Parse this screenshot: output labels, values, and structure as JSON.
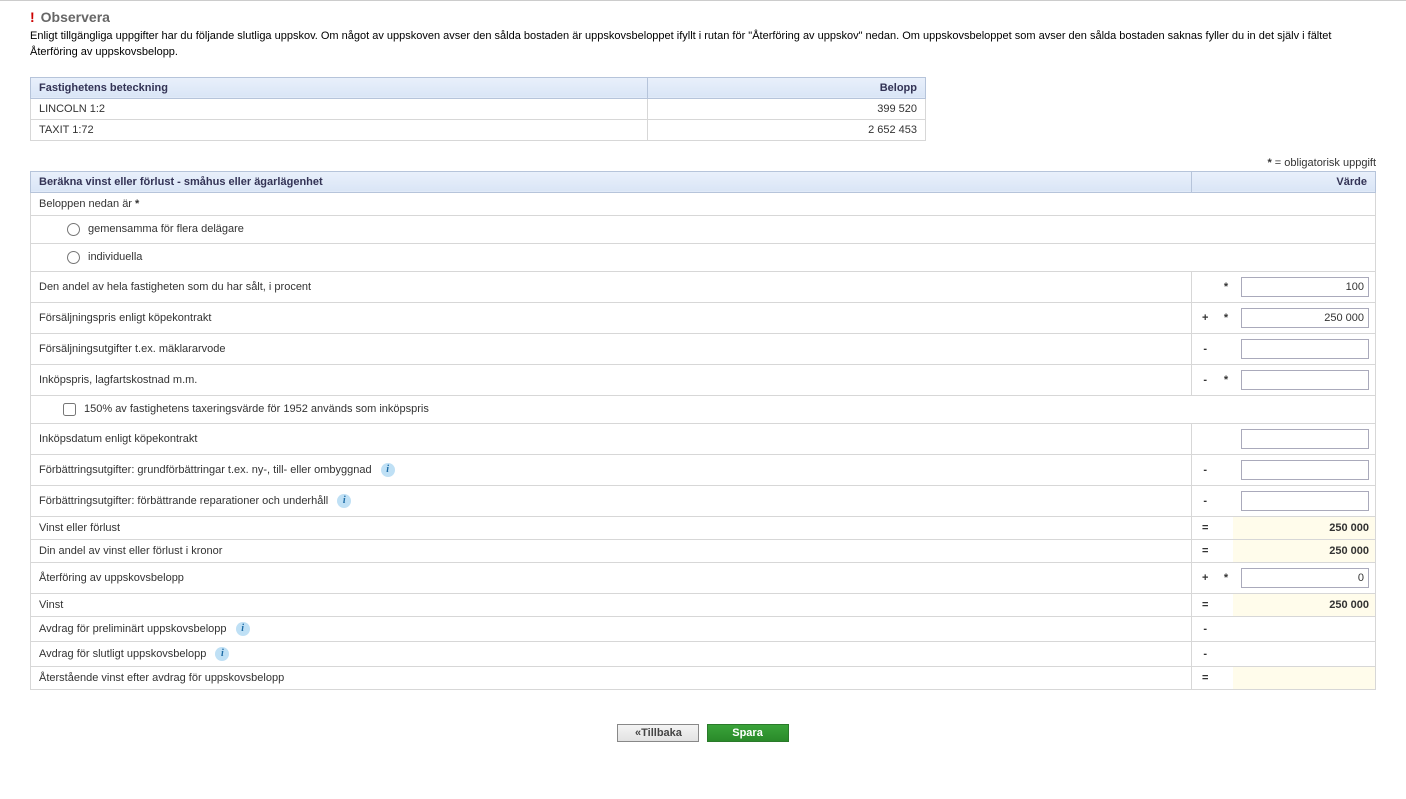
{
  "notice": {
    "title": "Observera",
    "body": "Enligt tillgängliga uppgifter har du följande slutliga uppskov. Om något av uppskoven avser den sålda bostaden är uppskovsbeloppet ifyllt i rutan för \"Återföring av uppskov\" nedan. Om uppskovsbeloppet som avser den sålda bostaden saknas fyller du in det själv i fältet Återföring av uppskovsbelopp."
  },
  "data_table": {
    "headers": {
      "designation": "Fastighetens beteckning",
      "amount": "Belopp"
    },
    "rows": [
      {
        "designation": "LINCOLN 1:2",
        "amount": "399 520"
      },
      {
        "designation": "TAXIT 1:72",
        "amount": "2 652 453"
      }
    ]
  },
  "mandatory_note": {
    "ast": "*",
    "text": "= obligatorisk uppgift"
  },
  "form": {
    "header_left": "Beräkna vinst eller förlust - småhus eller ägarlägenhet",
    "header_right": "Värde",
    "group_label": "Beloppen nedan är",
    "radio_shared": "gemensamma för flera delägare",
    "radio_individual": "individuella",
    "rows": {
      "share": {
        "label": "Den andel av hela fastigheten som du har sålt, i procent",
        "op": "",
        "ast": "*",
        "value": "100"
      },
      "saleprice": {
        "label": "Försäljningspris enligt köpekontrakt",
        "op": "+",
        "ast": "*",
        "value": "250 000"
      },
      "saleexp": {
        "label": "Försäljningsutgifter t.ex. mäklararvode",
        "op": "-",
        "ast": "",
        "value": ""
      },
      "purchase": {
        "label": "Inköpspris, lagfartskostnad m.m.",
        "op": "-",
        "ast": "*",
        "value": ""
      },
      "cb1952": {
        "label": "150% av fastighetens taxeringsvärde för 1952 används som inköpspris"
      },
      "purchasedate": {
        "label": "Inköpsdatum enligt köpekontrakt",
        "op": "",
        "ast": "",
        "value": ""
      },
      "improve1": {
        "label": "Förbättringsutgifter: grundförbättringar t.ex. ny-, till- eller ombyggnad",
        "op": "-",
        "ast": "",
        "value": ""
      },
      "improve2": {
        "label": "Förbättringsutgifter: förbättrande reparationer och underhåll",
        "op": "-",
        "ast": "",
        "value": ""
      },
      "profitloss": {
        "label": "Vinst eller förlust",
        "op": "=",
        "value": "250 000"
      },
      "yourshare": {
        "label": "Din andel av vinst eller förlust i kronor",
        "op": "=",
        "value": "250 000"
      },
      "reversal": {
        "label": "Återföring av uppskovsbelopp",
        "op": "+",
        "ast": "*",
        "value": "0"
      },
      "profit": {
        "label": "Vinst",
        "op": "=",
        "value": "250 000"
      },
      "dedprel": {
        "label": "Avdrag för preliminärt uppskovsbelopp",
        "op": "-",
        "value": ""
      },
      "dedfinal": {
        "label": "Avdrag för slutligt uppskovsbelopp",
        "op": "-",
        "value": ""
      },
      "remaining": {
        "label": "Återstående vinst efter avdrag för uppskovsbelopp",
        "op": "=",
        "value": ""
      }
    }
  },
  "buttons": {
    "back": "«Tillbaka",
    "save": "Spara"
  }
}
